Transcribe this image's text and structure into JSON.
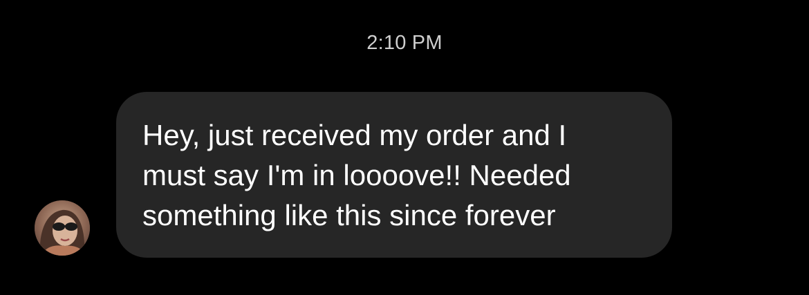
{
  "chat": {
    "timestamp": "2:10 PM",
    "message": {
      "text": "Hey, just received my order and I\nmust say I'm in loooove!! Needed\nsomething like this since forever",
      "bubble_color": "#262626",
      "text_color": "#ffffff"
    },
    "avatar_icon": "user-avatar-photo"
  },
  "theme": {
    "background": "#000000",
    "timestamp_color": "#cfcfcf"
  }
}
